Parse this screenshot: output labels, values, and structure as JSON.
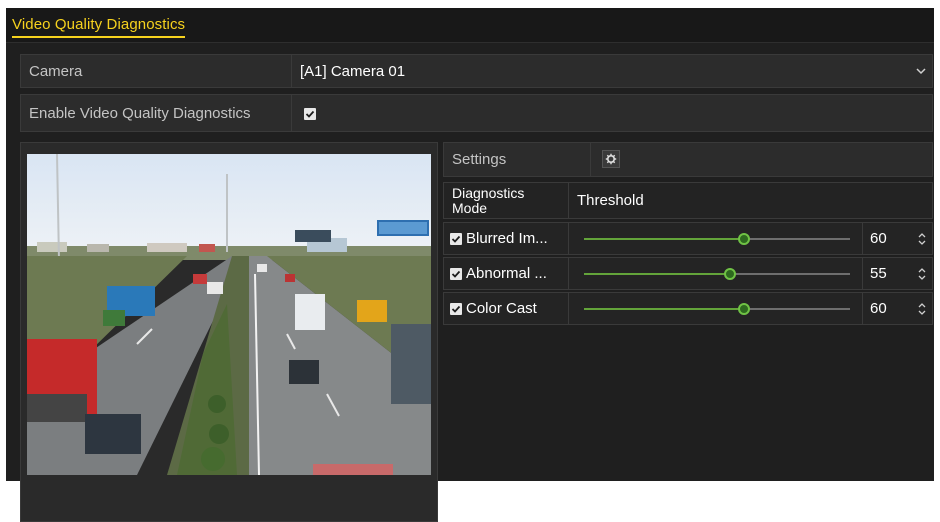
{
  "tab": {
    "label": "Video Quality Diagnostics"
  },
  "camera": {
    "label": "Camera",
    "value": "[A1] Camera 01",
    "icon": "chevron-down-icon"
  },
  "enable": {
    "label": "Enable Video Quality Diagnostics",
    "checked": true
  },
  "settings": {
    "label": "Settings",
    "icon": "gear-icon"
  },
  "table": {
    "mode_header": "Diagnostics Mode",
    "threshold_header": "Threshold",
    "rows": [
      {
        "name": "Blurred Im...",
        "checked": true,
        "value": "60",
        "level": 0.6
      },
      {
        "name": "Abnormal ...",
        "checked": true,
        "value": "55",
        "level": 0.55
      },
      {
        "name": "Color Cast",
        "checked": true,
        "value": "60",
        "level": 0.6
      }
    ]
  },
  "colors": {
    "accent": "#f6d21e",
    "slider": "#63a43a"
  }
}
